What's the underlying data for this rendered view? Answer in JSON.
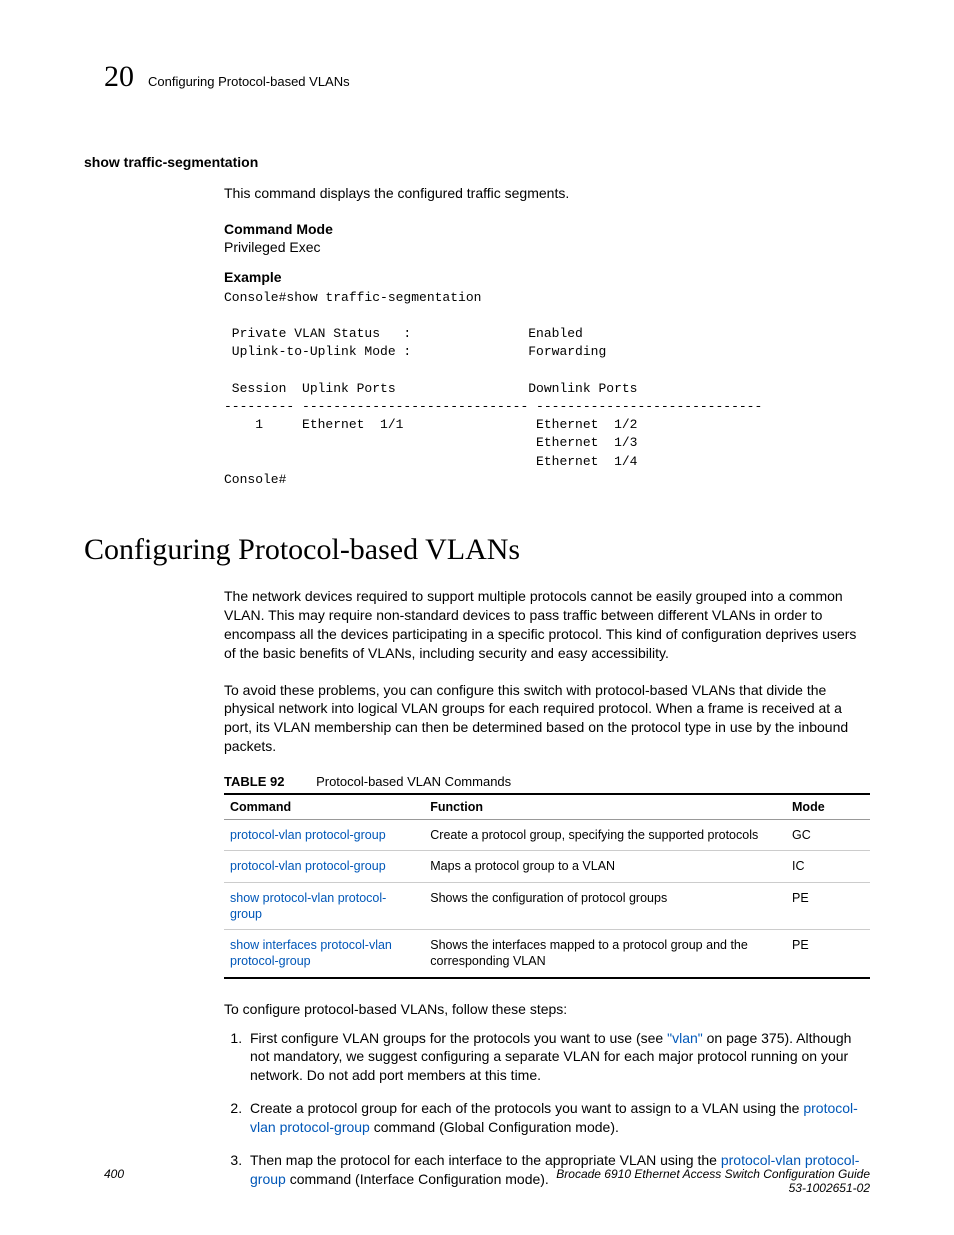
{
  "header": {
    "chapter_num": "20",
    "chapter_title": "Configuring Protocol-based VLANs"
  },
  "cmd_section": {
    "title": "show traffic-segmentation",
    "desc": "This command displays the configured traffic segments.",
    "mode_label": "Command Mode",
    "mode_value": "Privileged Exec",
    "example_label": "Example",
    "cli": "Console#show traffic-segmentation\n\n Private VLAN Status   :               Enabled\n Uplink-to-Uplink Mode :               Forwarding\n\n Session  Uplink Ports                 Downlink Ports\n--------- ----------------------------- -----------------------------\n    1     Ethernet  1/1                 Ethernet  1/2\n                                        Ethernet  1/3\n                                        Ethernet  1/4\nConsole#"
  },
  "main": {
    "title": "Configuring Protocol-based VLANs",
    "para1": "The network devices required to support multiple protocols cannot be easily grouped into a common VLAN. This may require non-standard devices to pass traffic between different VLANs in order to encompass all the devices participating in a specific protocol. This kind of configuration deprives users of the basic benefits of VLANs, including security and easy accessibility.",
    "para2": "To avoid these problems, you can configure this switch with protocol-based VLANs that divide the physical network into logical VLAN groups for each required protocol. When a frame is received at a port, its VLAN membership can then be determined based on the protocol type in use by the inbound packets."
  },
  "table": {
    "label": "TABLE 92",
    "caption": "Protocol-based VLAN Commands",
    "headers": {
      "c1": "Command",
      "c2": "Function",
      "c3": "Mode"
    },
    "rows": [
      {
        "cmd": "protocol-vlan protocol-group",
        "func": "Create a protocol group, specifying the supported protocols",
        "mode": "GC"
      },
      {
        "cmd": "protocol-vlan protocol-group",
        "func": "Maps a protocol group to a VLAN",
        "mode": "IC"
      },
      {
        "cmd": "show protocol-vlan protocol-group",
        "func": "Shows the configuration of protocol groups",
        "mode": "PE"
      },
      {
        "cmd": "show interfaces protocol-vlan protocol-group",
        "func": "Shows the interfaces mapped to a protocol group and the corresponding VLAN",
        "mode": "PE"
      }
    ]
  },
  "steps": {
    "intro": "To configure protocol-based VLANs, follow these steps:",
    "s1a": "First configure VLAN groups for the protocols you want to use (see ",
    "s1link": "\"vlan\"",
    "s1b": " on page 375). Although not mandatory, we suggest configuring a separate VLAN for each major protocol running on your network. Do not add port members at this time.",
    "s2a": "Create a protocol group for each of the protocols you want to assign to a VLAN using the ",
    "s2link": "protocol-vlan protocol-group",
    "s2b": " command (Global Configuration mode).",
    "s3a": "Then map the protocol for each interface to the appropriate VLAN using the ",
    "s3link": "protocol-vlan protocol-group",
    "s3b": " command (Interface Configuration mode)."
  },
  "footer": {
    "page": "400",
    "title": "Brocade 6910 Ethernet Access Switch Configuration Guide",
    "docnum": "53-1002651-02"
  }
}
